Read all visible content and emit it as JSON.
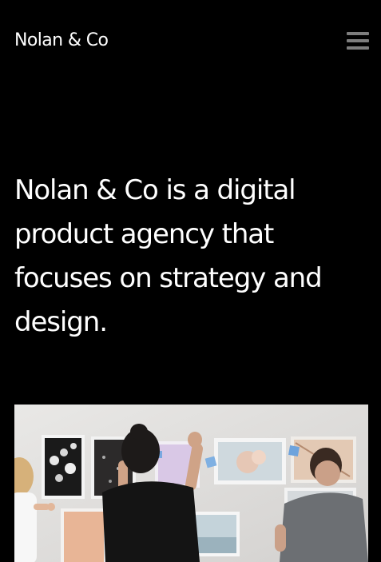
{
  "header": {
    "brand": "Nolan & Co",
    "menu_icon": "hamburger-menu-icon",
    "menu_icon_color": "#7d7d7d"
  },
  "hero": {
    "headline": "Nolan & Co is a digital product agency that focuses on strategy and design.",
    "image_description_icon": "team-moodboard-photo"
  },
  "colors": {
    "background": "#000000",
    "text": "#ffffff"
  }
}
